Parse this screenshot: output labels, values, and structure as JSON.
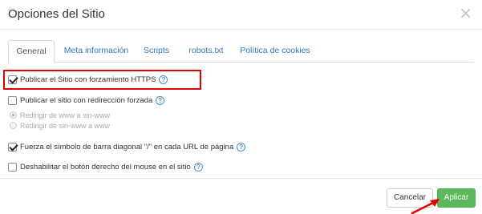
{
  "dialog": {
    "title": "Opciones del Sitio",
    "close_label": "×"
  },
  "tabs": [
    {
      "label": "General"
    },
    {
      "label": "Meta información"
    },
    {
      "label": "Scripts"
    },
    {
      "label": "robots.txt"
    },
    {
      "label": "Política de cookies"
    }
  ],
  "options": {
    "force_https": {
      "label": "Publicar el Sitio con forzamiento HTTPS",
      "checked": true
    },
    "forced_redirect": {
      "label": "Publicar el sitio con redirección forzada",
      "checked": false
    },
    "redirect_www_to_non": {
      "label": "Redirigir de www a sin-www",
      "selected": true
    },
    "redirect_non_to_www": {
      "label": "Redirigir de sin-www a www",
      "selected": false
    },
    "trailing_slash": {
      "label": "Fuerza el símbolo de barra diagonal \"/\" en cada URL de página",
      "checked": true
    },
    "disable_right_click": {
      "label": "Deshabilitar el botón derecho del mouse en el sitio",
      "checked": false
    }
  },
  "help_glyph": "?",
  "footer": {
    "cancel_label": "Cancelar",
    "apply_label": "Aplicar"
  },
  "colors": {
    "highlight": "#e00000",
    "apply_button": "#5cb85c",
    "link": "#337ab7",
    "arrow": "#e00000"
  },
  "icons": {
    "help": "question-circle-icon",
    "close": "close-icon",
    "annotation": "arrow-icon"
  }
}
